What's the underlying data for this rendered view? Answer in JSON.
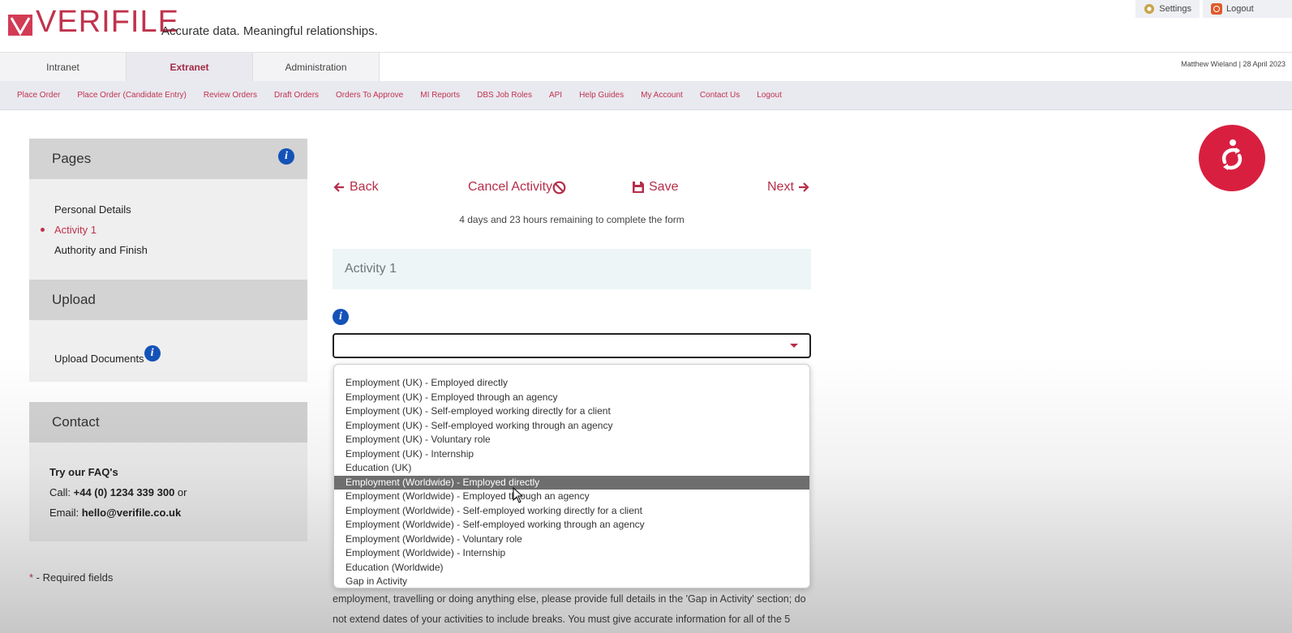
{
  "brand": {
    "name": "VERIFILE",
    "tagline": "Accurate data. Meaningful relationships.",
    "color": "#c0334d"
  },
  "top_links": [
    {
      "label": "Settings",
      "icon": "gear-icon"
    },
    {
      "label": "Logout",
      "icon": "power-icon"
    }
  ],
  "tabs": [
    {
      "label": "Intranet",
      "active": false
    },
    {
      "label": "Extranet",
      "active": true
    },
    {
      "label": "Administration",
      "active": false
    }
  ],
  "user_date": "Matthew Wieland | 28 April 2023",
  "subnav": [
    "Place Order",
    "Place Order (Candidate Entry)",
    "Review Orders",
    "Draft Orders",
    "Orders To Approve",
    "MI Reports",
    "DBS Job Roles",
    "API",
    "Help Guides",
    "My Account",
    "Contact Us",
    "Logout"
  ],
  "sidebar": {
    "pages": {
      "title": "Pages",
      "items": [
        {
          "label": "Personal Details",
          "active": false
        },
        {
          "label": "Activity 1",
          "active": true
        },
        {
          "label": "Authority and Finish",
          "active": false
        }
      ]
    },
    "upload": {
      "title": "Upload",
      "item": "Upload Documents"
    },
    "contact": {
      "title": "Contact",
      "faq": "Try our FAQ's",
      "call_prefix": "Call: ",
      "phone": "+44 (0) 1234 339 300",
      "call_suffix": " or",
      "email_prefix": "Email: ",
      "email": "hello@verifile.co.uk"
    },
    "required_star": "*",
    "required_note": " - Required fields"
  },
  "form_nav": {
    "back": "Back",
    "cancel": "Cancel Activity",
    "save": "Save",
    "next": "Next"
  },
  "remaining": "4 days and 23 hours remaining to complete the form",
  "section_title": "Activity 1",
  "activity_select": {
    "value": "",
    "highlighted_index": 7,
    "options": [
      "Employment (UK) - Employed directly",
      "Employment (UK) - Employed through an agency",
      "Employment (UK) - Self-employed working directly for a client",
      "Employment (UK) - Self-employed working through an agency",
      "Employment (UK) - Voluntary role",
      "Employment (UK) - Internship",
      "Education (UK)",
      "Employment (Worldwide) - Employed directly",
      "Employment (Worldwide) - Employed through an agency",
      "Employment (Worldwide) - Self-employed working directly for a client",
      "Employment (Worldwide) - Self-employed working through an agency",
      "Employment (Worldwide) - Voluntary role",
      "Employment (Worldwide) - Internship",
      "Education (Worldwide)",
      "Gap in Activity"
    ]
  },
  "body_text": [
    "employment, travelling or doing anything else, please provide full details in the 'Gap in Activity' section; do",
    "not extend dates of your activities to include breaks. You must give accurate information for all of the 5"
  ]
}
